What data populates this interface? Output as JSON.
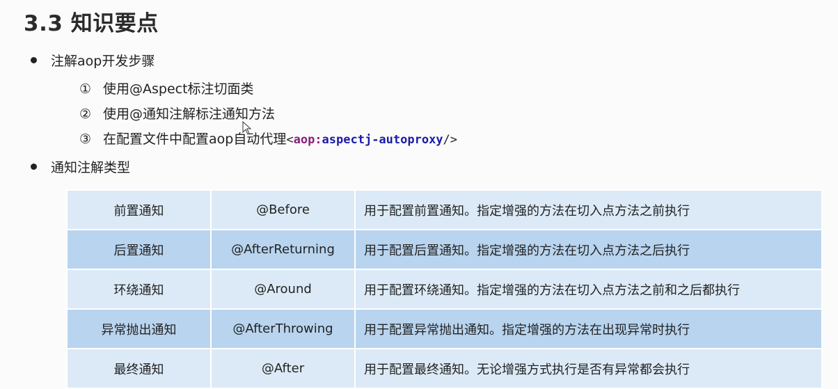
{
  "title": "3.3 知识要点",
  "bullets": [
    {
      "label": "注解aop开发步骤",
      "steps": [
        {
          "num": "①",
          "text": "使用@Aspect标注切面类"
        },
        {
          "num": "②",
          "text": "使用@通知注解标注通知方法"
        },
        {
          "num": "③",
          "text": "在配置文件中配置aop自动代理",
          "code_open": "<",
          "code_ns": "aop:",
          "code_name": "aspectj-autoproxy",
          "code_close": "/>"
        }
      ]
    },
    {
      "label": "通知注解类型"
    }
  ],
  "table": {
    "rows": [
      {
        "name": "前置通知",
        "annotation": "@Before",
        "description": "用于配置前置通知。指定增强的方法在切入点方法之前执行"
      },
      {
        "name": "后置通知",
        "annotation": "@AfterReturning",
        "description": "用于配置后置通知。指定增强的方法在切入点方法之后执行"
      },
      {
        "name": "环绕通知",
        "annotation": "@Around",
        "description": "用于配置环绕通知。指定增强的方法在切入点方法之前和之后都执行"
      },
      {
        "name": "异常抛出通知",
        "annotation": "@AfterThrowing",
        "description": "用于配置异常抛出通知。指定增强的方法在出现异常时执行"
      },
      {
        "name": "最终通知",
        "annotation": "@After",
        "description": "用于配置最终通知。无论增强方式执行是否有异常都会执行"
      }
    ]
  },
  "colors": {
    "row_light": "#dceaf7",
    "row_dark": "#b8d4ef",
    "code_namespace": "#8a1f7a",
    "code_name": "#1b1ba8"
  }
}
